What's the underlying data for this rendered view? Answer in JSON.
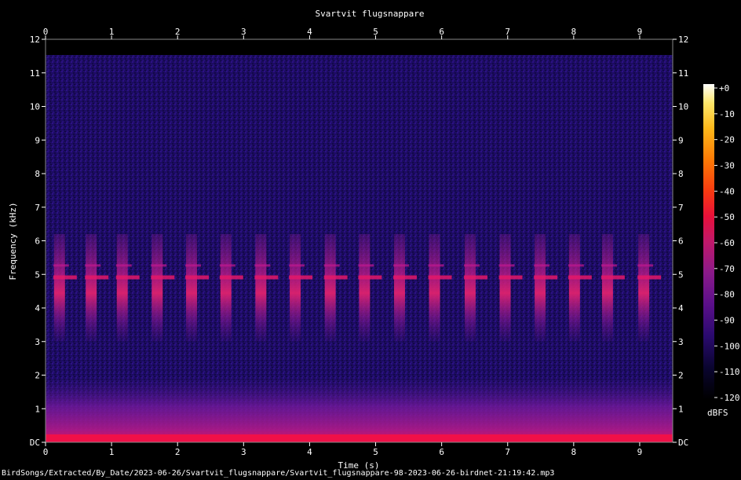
{
  "chart_data": {
    "type": "heatmap",
    "title": "Svartvit flugsnappare",
    "xlabel": "Time (s)",
    "ylabel": "Frequency (kHz)",
    "x_ticks": [
      "0",
      "1",
      "2",
      "3",
      "4",
      "5",
      "6",
      "7",
      "8",
      "9"
    ],
    "y_ticks": [
      "DC",
      "1",
      "2",
      "3",
      "4",
      "5",
      "6",
      "7",
      "8",
      "9",
      "10",
      "11",
      "12"
    ],
    "xlim": [
      0,
      9.5
    ],
    "ylim": [
      0,
      12
    ],
    "colorbar": {
      "label": "dBFS",
      "ticks": [
        "+0",
        "-10",
        "-20",
        "-30",
        "-40",
        "-50",
        "-60",
        "-70",
        "-80",
        "-90",
        "-100",
        "-110",
        "-120"
      ],
      "range": [
        -120,
        0
      ],
      "colors": [
        "#000000",
        "#0a0530",
        "#2a0a6e",
        "#5a0f8a",
        "#8a1a8a",
        "#c0186a",
        "#e8103a",
        "#f83a10",
        "#fc7a05",
        "#fdb81a",
        "#fde66a",
        "#ffffff"
      ]
    },
    "background_colors": [
      "#170a52",
      "#2a0e7a"
    ],
    "syllable_times_s": [
      0.2,
      0.68,
      1.15,
      1.68,
      2.2,
      2.72,
      3.25,
      3.77,
      4.3,
      4.82,
      5.35,
      5.88,
      6.42,
      6.95,
      7.48,
      8.0,
      8.5,
      9.05
    ],
    "syllable_band_khz": [
      3.0,
      6.2
    ],
    "syllable_peak_khz": 4.9,
    "low_band_khz": [
      0,
      1.2
    ]
  },
  "footer_text": "BirdSongs/Extracted/By_Date/2023-06-26/Svartvit_flugsnappare/Svartvit_flugsnappare-98-2023-06-26-birdnet-21:19:42.mp3"
}
